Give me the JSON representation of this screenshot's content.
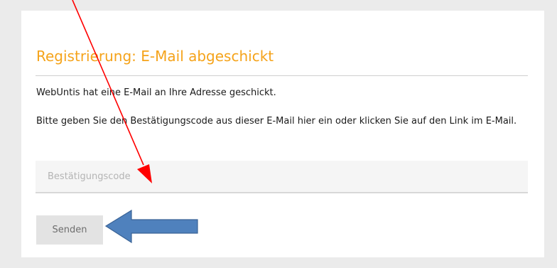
{
  "header": {
    "title": "Registrierung: E-Mail abgeschickt"
  },
  "main": {
    "sent_notice": "WebUntis hat eine E-Mail an Ihre Adresse geschickt.",
    "instructions": "Bitte geben Sie den Bestätigungscode aus dieser E-Mail hier ein oder klicken Sie auf den Link im E-Mail.",
    "code_field": {
      "placeholder": "Bestätigungscode",
      "value": ""
    },
    "send_label": "Senden"
  },
  "colors": {
    "title_accent": "#f5a31a",
    "red_arrow": "#ff0000",
    "blue_arrow_fill": "#4f81bd",
    "blue_arrow_stroke": "#3a6396"
  }
}
